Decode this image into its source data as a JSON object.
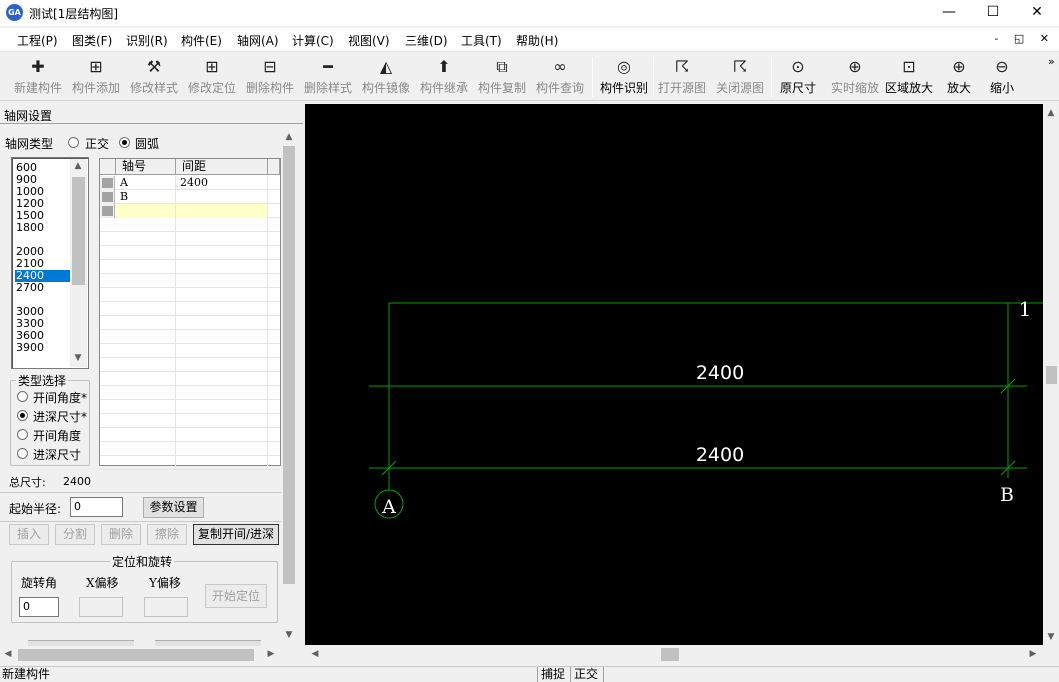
{
  "window": {
    "title": "测试[1层结构图]",
    "app_icon_text": "GA",
    "minimize": "—",
    "maximize": "☐",
    "close": "✕"
  },
  "menu": [
    {
      "label": "工程(P)"
    },
    {
      "label": "图类(F)"
    },
    {
      "label": "识别(R)"
    },
    {
      "label": "构件(E)"
    },
    {
      "label": "轴网(A)"
    },
    {
      "label": "计算(C)"
    },
    {
      "label": "视图(V)"
    },
    {
      "label": "三维(D)"
    },
    {
      "label": "工具(T)"
    },
    {
      "label": "帮助(H)"
    }
  ],
  "mdi_controls": "‑ ◱ ✕",
  "toolbar": {
    "group1": [
      {
        "label": "新建构件",
        "icon": "plus-icon",
        "glyph": "✚",
        "enabled": false
      },
      {
        "label": "构件添加",
        "icon": "component-add-icon",
        "glyph": "⊞",
        "enabled": false
      },
      {
        "label": "修改样式",
        "icon": "wrench-icon",
        "glyph": "⚒",
        "enabled": false
      },
      {
        "label": "修改定位",
        "icon": "move-icon",
        "glyph": "⊞",
        "enabled": false
      },
      {
        "label": "删除构件",
        "icon": "delete-component-icon",
        "glyph": "⊟",
        "enabled": false
      },
      {
        "label": "删除样式",
        "icon": "minus-icon",
        "glyph": "━",
        "enabled": false
      },
      {
        "label": "构件镜像",
        "icon": "mirror-icon",
        "glyph": "◭",
        "enabled": false
      },
      {
        "label": "构件继承",
        "icon": "inherit-icon",
        "glyph": "⬆",
        "enabled": false
      },
      {
        "label": "构件复制",
        "icon": "copy-icon",
        "glyph": "⧉",
        "enabled": false
      },
      {
        "label": "构件查询",
        "icon": "binoculars-icon",
        "glyph": "∞",
        "enabled": false
      }
    ],
    "group2": [
      {
        "label": "构件识别",
        "icon": "target-icon",
        "glyph": "◎",
        "enabled": true
      },
      {
        "label": "打开源图",
        "icon": "open-source-icon",
        "glyph": "☈",
        "enabled": false
      },
      {
        "label": "关闭源图",
        "icon": "close-source-icon",
        "glyph": "☈",
        "enabled": false
      }
    ],
    "group3": [
      {
        "label": "原尺寸",
        "icon": "zoom-original-icon",
        "glyph": "⊙",
        "enabled": true
      },
      {
        "label": "实时缩放",
        "icon": "zoom-realtime-icon",
        "glyph": "⊕",
        "enabled": false
      },
      {
        "label": "区域放大",
        "icon": "zoom-area-icon",
        "glyph": "⊡",
        "enabled": true
      },
      {
        "label": "放大",
        "icon": "zoom-in-icon",
        "glyph": "⊕",
        "enabled": true
      },
      {
        "label": "缩小",
        "icon": "zoom-out-icon",
        "glyph": "⊖",
        "enabled": true
      }
    ],
    "overflow": "»"
  },
  "panel": {
    "title": "轴网设置",
    "axis_type_label": "轴网类型",
    "axis_type_options": [
      {
        "label": "正交",
        "checked": false
      },
      {
        "label": "圆弧",
        "checked": true
      }
    ],
    "spacing_list": [
      "600",
      "900",
      "1000",
      "1200",
      "1500",
      "1800",
      "",
      "2000",
      "2100",
      "2400",
      "2700",
      "",
      "3000",
      "3300",
      "3600",
      "3900"
    ],
    "selected_spacing": "2400",
    "grid": {
      "headers": [
        "轴号",
        "间距"
      ],
      "rows": [
        {
          "axis": "A",
          "spacing": "2400"
        },
        {
          "axis": "B",
          "spacing": ""
        },
        {
          "axis": "",
          "spacing": ""
        }
      ]
    },
    "type_selection": {
      "title": "类型选择",
      "options": [
        {
          "label": "开间角度*",
          "checked": false
        },
        {
          "label": "进深尺寸*",
          "checked": true
        },
        {
          "label": "开间角度",
          "checked": false
        },
        {
          "label": "进深尺寸",
          "checked": false
        }
      ]
    },
    "total_size_label": "总尺寸:",
    "total_size_value": "2400",
    "start_radius_label": "起始半径:",
    "start_radius_value": "0",
    "param_button": "参数设置",
    "buttons": {
      "insert": "插入",
      "split": "分割",
      "delete": "删除",
      "erase": "擦除",
      "copy": "复制开间/进深"
    },
    "position": {
      "title": "定位和旋转",
      "rotate_label": "旋转角",
      "xoffset_label": "X偏移",
      "yoffset_label": "Y偏移",
      "rotate_value": "0",
      "xoffset_value": "",
      "yoffset_value": "",
      "start_button": "开始定位"
    }
  },
  "canvas": {
    "background": "#000000",
    "line_color": "#00a000",
    "text_color": "#ffffff",
    "dimension_top": "2400",
    "dimension_bottom": "2400",
    "axis_label_right_top": "1",
    "axis_label_left": "A",
    "axis_label_right": "B"
  },
  "statusbar": {
    "message": "新建构件",
    "snap": "捕捉",
    "ortho": "正交"
  }
}
